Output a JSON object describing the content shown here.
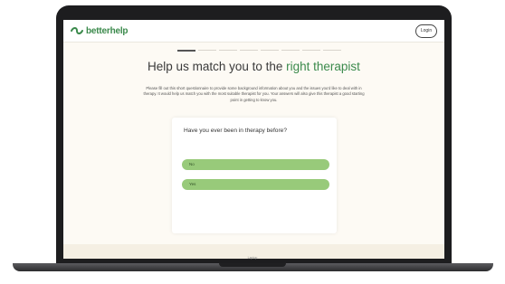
{
  "app": {
    "logo_text": "betterhelp",
    "login_label": "Login"
  },
  "progress": {
    "total_steps": 8,
    "current_step": 1
  },
  "headline": {
    "prefix": "Help us match you to the ",
    "accent": "right therapist"
  },
  "intro": "Please fill out this short questionnaire to provide some background information about you and the issues you'd like to deal with in therapy. It would help us match you with the most suitable therapist for you. Your answers will also give this therapist a good starting point in getting to know you.",
  "question": {
    "text": "Have you ever been in therapy before?",
    "options": [
      "No",
      "Yes"
    ]
  },
  "device_label": "Laptop",
  "colors": {
    "brand_green": "#3b8a4c",
    "option_green": "#98ca7a",
    "page_bg": "#fdfaf4"
  }
}
